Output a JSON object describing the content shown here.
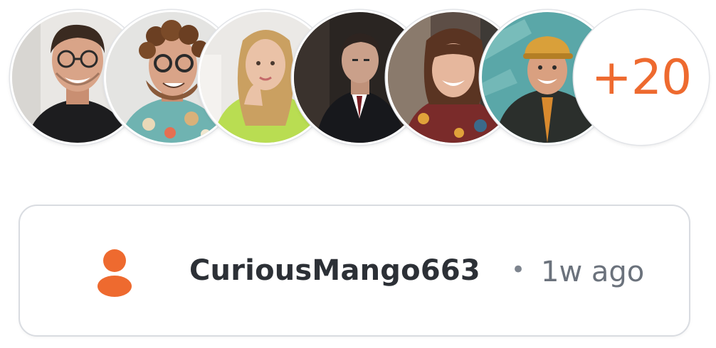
{
  "avatars": [
    {
      "name": "avatar-1",
      "alt": "man with glasses smiling"
    },
    {
      "name": "avatar-2",
      "alt": "man with curly hair and glasses"
    },
    {
      "name": "avatar-3",
      "alt": "woman in green sweater"
    },
    {
      "name": "avatar-4",
      "alt": "man in dark suit"
    },
    {
      "name": "avatar-5",
      "alt": "woman with bangs smiling"
    },
    {
      "name": "avatar-6",
      "alt": "man in orange cap"
    }
  ],
  "overflow_count": "+20",
  "post_meta": {
    "icon": "user-icon",
    "username": "CuriousMango663",
    "separator": "•",
    "timestamp": "1w ago"
  },
  "colors": {
    "accent": "#ee6a2f",
    "text_primary": "#2c3036",
    "text_secondary": "#6b727c",
    "border": "#d9dce1"
  }
}
